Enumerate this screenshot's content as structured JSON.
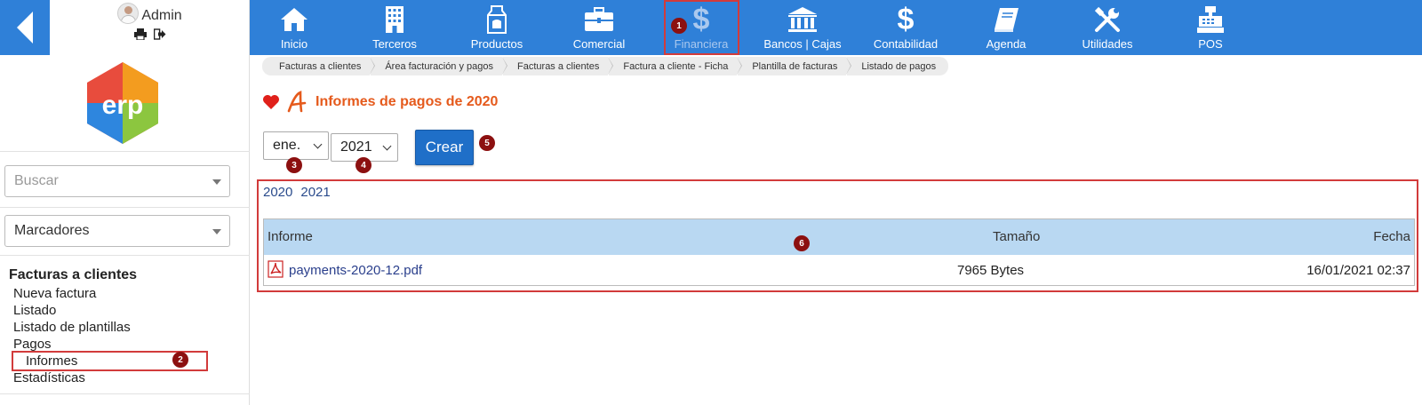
{
  "user": {
    "name": "Admin"
  },
  "nav": [
    {
      "label": "Inicio",
      "icon": "home-icon"
    },
    {
      "label": "Terceros",
      "icon": "building-icon"
    },
    {
      "label": "Productos",
      "icon": "milk-box-icon"
    },
    {
      "label": "Comercial",
      "icon": "briefcase-icon"
    },
    {
      "label": "Financiera",
      "icon": "dollar-icon",
      "active": true
    },
    {
      "label": "Bancos | Cajas",
      "icon": "bank-icon"
    },
    {
      "label": "Contabilidad",
      "icon": "dollar-icon"
    },
    {
      "label": "Agenda",
      "icon": "book-icon"
    },
    {
      "label": "Utilidades",
      "icon": "tools-icon"
    },
    {
      "label": "POS",
      "icon": "cash-register-icon"
    }
  ],
  "breadcrumb": [
    "Facturas a clientes",
    "Área facturación y pagos",
    "Facturas a clientes",
    "Factura a cliente - Ficha",
    "Plantilla de facturas",
    "Listado de pagos"
  ],
  "sidebar": {
    "search_placeholder": "Buscar",
    "bookmarks_label": "Marcadores",
    "menu_title": "Facturas a clientes",
    "items": [
      "Nueva factura",
      "Listado",
      "Listado de plantillas",
      "Pagos",
      "Informes",
      "Estadísticas"
    ]
  },
  "page_title": "Informes de pagos de 2020",
  "form": {
    "month": "ene.",
    "year": "2021",
    "create_label": "Crear"
  },
  "year_links": [
    "2020",
    "2021"
  ],
  "table": {
    "headers": {
      "report": "Informe",
      "size": "Tamaño",
      "date": "Fecha"
    },
    "rows": [
      {
        "file": "payments-2020-12.pdf",
        "size": "7965 Bytes",
        "date": "16/01/2021 02:37"
      }
    ]
  },
  "annotations": [
    "1",
    "2",
    "3",
    "4",
    "5",
    "6"
  ],
  "colors": {
    "nav_bg": "#2f80d8",
    "title_orange": "#e55a1c",
    "button_blue": "#1f6fc8",
    "table_header": "#b9d8f2",
    "highlight_red": "#d23b3b"
  }
}
